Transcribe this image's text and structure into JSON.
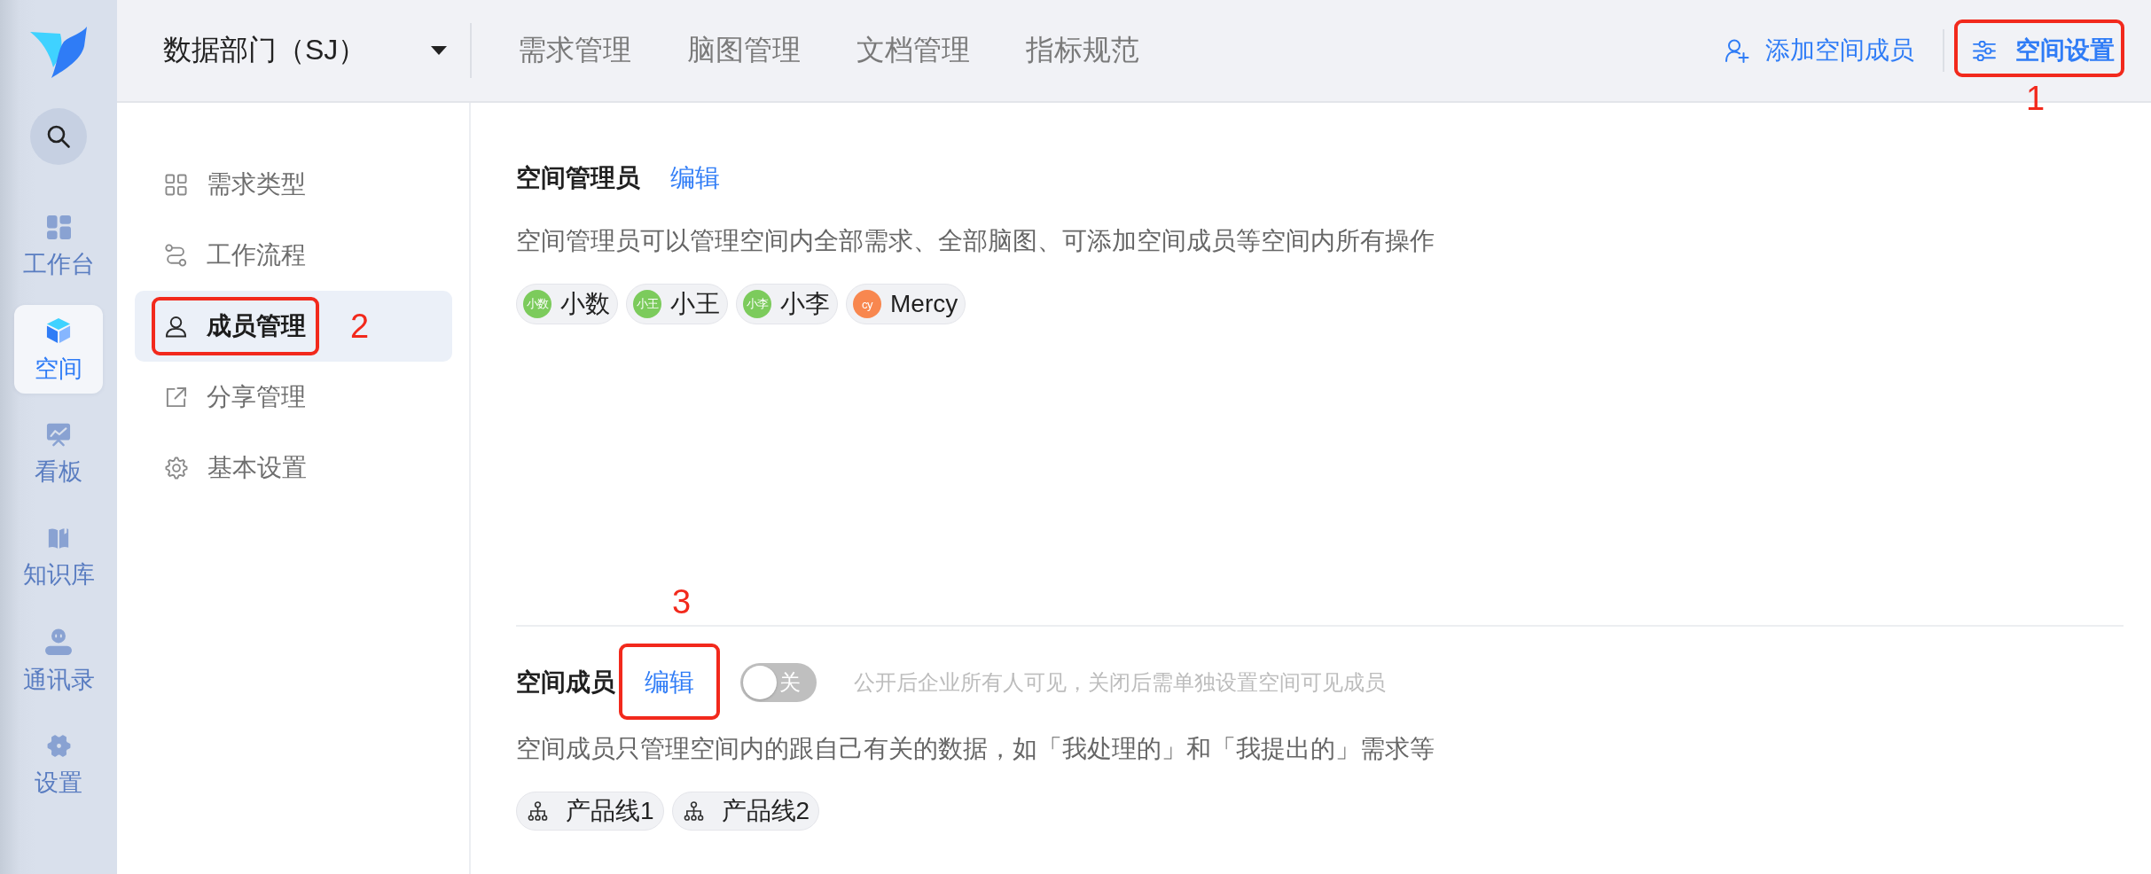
{
  "sidebar": {
    "items": [
      {
        "label": "工作台",
        "selected": false
      },
      {
        "label": "空间",
        "selected": true
      },
      {
        "label": "看板",
        "selected": false
      },
      {
        "label": "知识库",
        "selected": false
      },
      {
        "label": "通讯录",
        "selected": false
      },
      {
        "label": "设置",
        "selected": false
      }
    ]
  },
  "top_bar": {
    "department": "数据部门（SJ）",
    "tabs": [
      {
        "label": "需求管理",
        "selected": false
      },
      {
        "label": "脑图管理",
        "selected": false
      },
      {
        "label": "文档管理",
        "selected": false
      },
      {
        "label": "指标规范",
        "selected": false
      }
    ],
    "add_member": "添加空间成员",
    "settings_button": {
      "label": "空间设置",
      "annotation": "1"
    }
  },
  "settings_nav": {
    "items": [
      {
        "label": "需求类型",
        "selected": false
      },
      {
        "label": "工作流程",
        "selected": false
      },
      {
        "label": "成员管理",
        "selected": true,
        "annotation": "2"
      },
      {
        "label": "分享管理",
        "selected": false
      },
      {
        "label": "基本设置",
        "selected": false
      }
    ]
  },
  "admins": {
    "title": "空间管理员",
    "edit": {
      "label": "编辑"
    },
    "description": "空间管理员可以管理空间内全部需求、全部脑图、可添加空间成员等空间内所有操作",
    "members": [
      {
        "avatar": "小数",
        "name": "小数",
        "color": "#7ccb5c"
      },
      {
        "avatar": "小王",
        "name": "小王",
        "color": "#7ccb5c"
      },
      {
        "avatar": "小李",
        "name": "小李",
        "color": "#7ccb5c"
      },
      {
        "avatar": "cy",
        "name": "Mercy",
        "color": "#f8874f"
      }
    ]
  },
  "members_section": {
    "title": "空间成员",
    "edit": {
      "label": "编辑",
      "annotation": "3"
    },
    "toggle": {
      "on": false,
      "label": "关"
    },
    "hint": "公开后企业所有人可见，关闭后需单独设置空间可见成员",
    "description": "空间成员只管理空间内的跟自己有关的数据，如「我处理的」和「我提出的」需求等",
    "groups": [
      {
        "name": "产品线1"
      },
      {
        "name": "产品线2"
      }
    ]
  }
}
